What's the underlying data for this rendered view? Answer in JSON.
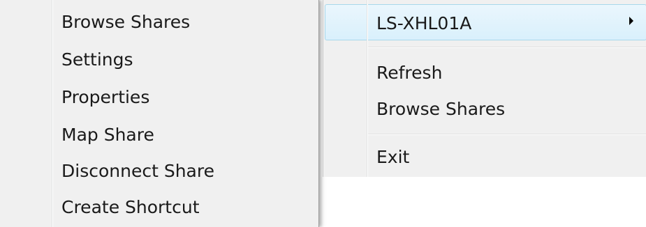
{
  "submenu": {
    "items": [
      {
        "label": "Browse Shares"
      },
      {
        "label": "Settings"
      },
      {
        "label": "Properties"
      },
      {
        "label": "Map Share"
      },
      {
        "label": "Disconnect Share"
      },
      {
        "label": "Create Shortcut"
      }
    ]
  },
  "context_menu": {
    "device_item": {
      "label": "LS-XHL01A",
      "icon": "chevron-right-icon",
      "highlighted": true
    },
    "items": [
      {
        "label": "Refresh"
      },
      {
        "label": "Browse Shares"
      },
      {
        "label": "Exit"
      }
    ]
  },
  "colors": {
    "menu_background": "#f0f0f0",
    "highlight_border": "#a8d8eb",
    "highlight_fill": "#e3f3fd",
    "text": "#1a1a1a"
  }
}
